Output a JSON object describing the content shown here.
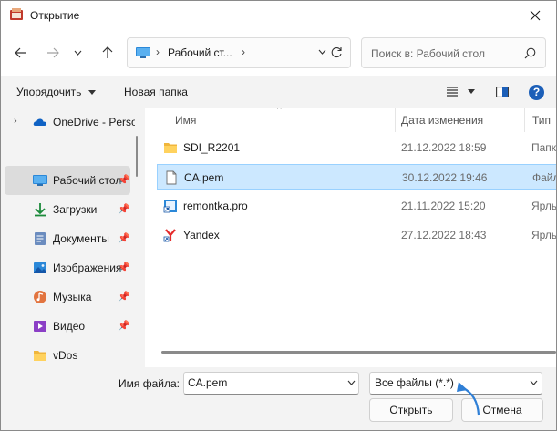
{
  "window": {
    "title": "Открытие"
  },
  "icons": {
    "app": "dialog-icon",
    "close": "close-icon",
    "back": "back-arrow-icon",
    "forward": "forward-arrow-icon",
    "recent": "chevron-down-icon",
    "up": "up-arrow-icon",
    "refresh": "refresh-icon",
    "search": "search-icon",
    "view": "view-list-icon",
    "preview": "preview-pane-icon",
    "help": "help-icon",
    "pin": "pin-icon"
  },
  "address": {
    "path": "Рабочий ст..."
  },
  "search": {
    "placeholder": "Поиск в: Рабочий стол"
  },
  "commandbar": {
    "organize": "Упорядочить",
    "new_folder": "Новая папка"
  },
  "help": {
    "label": "?"
  },
  "nav": {
    "items": [
      {
        "label": "OneDrive - Perso",
        "icon": "onedrive-icon",
        "expander": "›",
        "pinned": false,
        "selected": false
      },
      {
        "label": "Рабочий стол",
        "icon": "desktop-icon",
        "pinned": true,
        "selected": true
      },
      {
        "label": "Загрузки",
        "icon": "downloads-icon",
        "pinned": true,
        "selected": false
      },
      {
        "label": "Документы",
        "icon": "documents-icon",
        "pinned": true,
        "selected": false
      },
      {
        "label": "Изображения",
        "icon": "pictures-icon",
        "pinned": true,
        "selected": false
      },
      {
        "label": "Музыка",
        "icon": "music-icon",
        "pinned": true,
        "selected": false
      },
      {
        "label": "Видео",
        "icon": "video-icon",
        "pinned": true,
        "selected": false
      },
      {
        "label": "vDos",
        "icon": "folder-icon",
        "pinned": false,
        "selected": false
      }
    ]
  },
  "columns": {
    "name": "Имя",
    "date": "Дата изменения",
    "type": "Тип"
  },
  "files": [
    {
      "name": "SDI_R2201",
      "date": "21.12.2022 18:59",
      "type": "Папка",
      "icon": "folder-icon",
      "selected": false
    },
    {
      "name": "CA.pem",
      "date": "30.12.2022 19:46",
      "type": "Файл",
      "icon": "file-icon",
      "selected": true
    },
    {
      "name": "remontka.pro",
      "date": "21.11.2022 15:20",
      "type": "Ярлык",
      "icon": "shortcut-icon",
      "selected": false
    },
    {
      "name": "Yandex",
      "date": "27.12.2022 18:43",
      "type": "Ярлык",
      "icon": "yandex-icon",
      "selected": false
    }
  ],
  "bottom": {
    "filename_label": "Имя файла:",
    "filename_value": "CA.pem",
    "filetype_value": "Все файлы (*.*)",
    "open_label": "Открыть",
    "cancel_label": "Отмена"
  },
  "colors": {
    "accent": "#0067c0",
    "selection": "#cce8ff",
    "annotation_arrow": "#2f7fd6"
  }
}
